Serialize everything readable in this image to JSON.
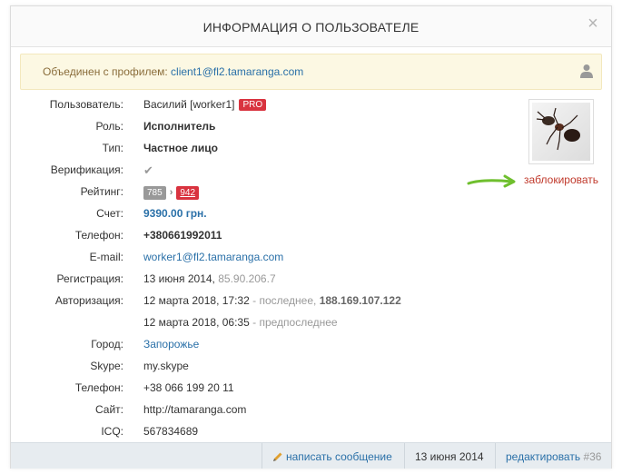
{
  "dialog": {
    "title": "ИНФОРМАЦИЯ О ПОЛЬЗОВАТЕЛЕ",
    "close": "×"
  },
  "merged": {
    "text": "Объединен с профилем:",
    "link": "client1@fl2.tamaranga.com"
  },
  "fields": {
    "user_label": "Пользователь:",
    "user_value": "Василий [worker1]",
    "pro_badge": "PRO",
    "role_label": "Роль:",
    "role_value": "Исполнитель",
    "type_label": "Тип:",
    "type_value": "Частное лицо",
    "verify_label": "Верификация:",
    "verify_mark": "✔",
    "rating_label": "Рейтинг:",
    "rating_old": "785",
    "rating_new": "942",
    "account_label": "Счет:",
    "account_value": "9390.00 грн.",
    "phone_label": "Телефон:",
    "phone_value": "+380661992011",
    "email_label": "E-mail:",
    "email_value": "worker1@fl2.tamaranga.com",
    "reg_label": "Регистрация:",
    "reg_date": "13 июня 2014,",
    "reg_ip": "85.90.206.7",
    "auth_label": "Авторизация:",
    "auth1_date": "12 марта 2018, 17:32",
    "auth1_note": " - последнее, ",
    "auth1_ip": "188.169.107.122",
    "auth2_date": "12 марта 2018, 06:35",
    "auth2_note": " - предпоследнее",
    "city_label": "Город:",
    "city_value": "Запорожье",
    "skype_label": "Skype:",
    "skype_value": "my.skype",
    "phone2_label": "Телефон:",
    "phone2_value": "+38 066 199 20 11",
    "site_label": "Сайт:",
    "site_value": "http://tamaranga.com",
    "icq_label": "ICQ:",
    "icq_value": "567834689"
  },
  "profile": {
    "block_link": "заблокировать"
  },
  "footer": {
    "write_message": "написать сообщение",
    "date": "13 июня 2014",
    "edit": "редактировать",
    "id": "#36"
  },
  "colors": {
    "accent": "#2a70a8",
    "danger": "#d9333f",
    "warning_bg": "#fcf8e3",
    "arrow": "#6fbf2e"
  }
}
